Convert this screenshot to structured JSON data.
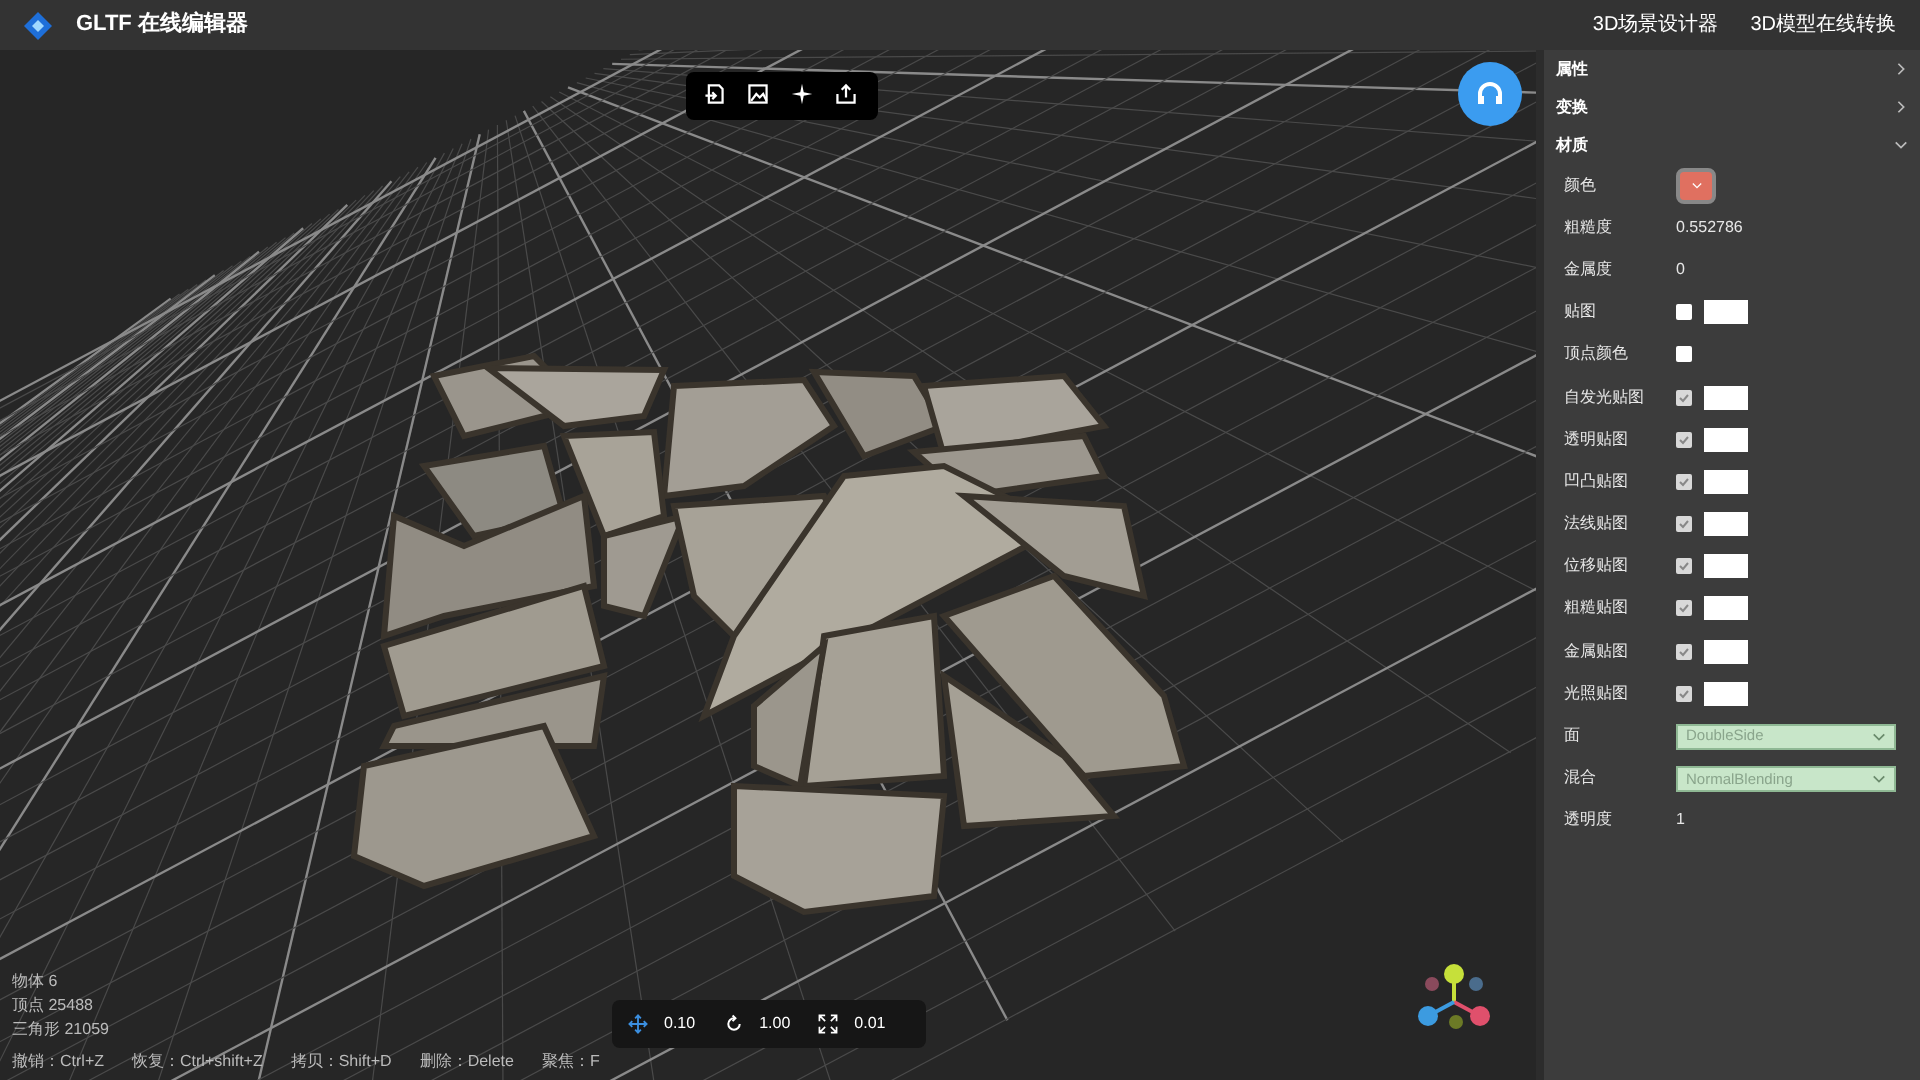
{
  "header": {
    "title": "GLTF 在线编辑器",
    "links": [
      "3D场景设计器",
      "3D模型在线转换"
    ]
  },
  "toolbar": {
    "buttons": [
      {
        "kind": "import"
      },
      {
        "kind": "image"
      },
      {
        "kind": "light"
      },
      {
        "kind": "export"
      }
    ]
  },
  "panel": {
    "sections": [
      {
        "label": "属性",
        "expanded": false
      },
      {
        "label": "变换",
        "expanded": false
      },
      {
        "label": "材质",
        "expanded": true
      }
    ],
    "rows": [
      {
        "kind": "color",
        "label": "颜色",
        "color": "#e07060"
      },
      {
        "kind": "text",
        "label": "粗糙度",
        "value": "0.552786"
      },
      {
        "kind": "text",
        "label": "金属度",
        "value": "0"
      },
      {
        "kind": "map",
        "label": "贴图",
        "checked": false
      },
      {
        "kind": "check",
        "label": "顶点颜色",
        "checked": false
      },
      {
        "kind": "map",
        "label": "自发光贴图",
        "checked": true
      },
      {
        "kind": "map",
        "label": "透明贴图",
        "checked": true
      },
      {
        "kind": "map",
        "label": "凹凸贴图",
        "checked": true
      },
      {
        "kind": "map",
        "label": "法线贴图",
        "checked": true
      },
      {
        "kind": "map",
        "label": "位移贴图",
        "checked": true
      },
      {
        "kind": "map",
        "label": "粗糙贴图",
        "checked": true
      },
      {
        "kind": "map",
        "label": "金属贴图",
        "checked": true
      },
      {
        "kind": "map",
        "label": "光照贴图",
        "checked": true
      },
      {
        "kind": "select",
        "label": "面",
        "value": "DoubleSide"
      },
      {
        "kind": "select",
        "label": "混合",
        "value": "NormalBlending"
      },
      {
        "kind": "text",
        "label": "透明度",
        "value": "1"
      }
    ]
  },
  "stats": [
    "物体 6",
    "顶点 25488",
    "三角形 21059"
  ],
  "steps": [
    {
      "kind": "move",
      "value": "0.10"
    },
    {
      "kind": "rotate",
      "value": "1.00"
    },
    {
      "kind": "scale",
      "value": "0.01"
    }
  ],
  "shortcuts": [
    "撤销：Ctrl+Z",
    "恢复：Ctrl+shift+Z",
    "拷贝：Shift+D",
    "删除：Delete",
    "聚焦：F"
  ]
}
